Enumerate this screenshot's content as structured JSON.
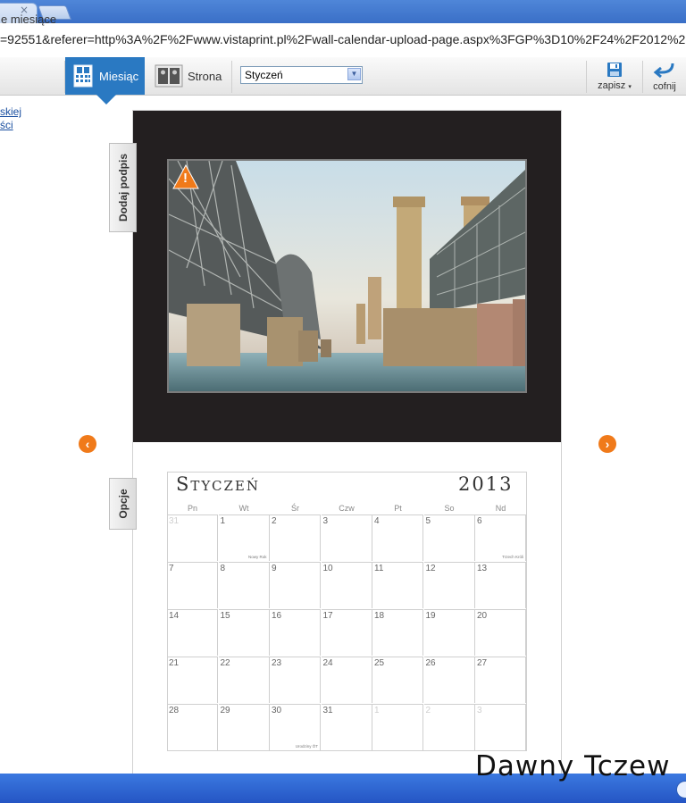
{
  "browser": {
    "url": "=92551&referer=http%3A%2F%2Fwww.vistaprint.pl%2Fwall-calendar-upload-page.aspx%3FGP%3D10%2F24%2F2012%2",
    "tab_close": "×"
  },
  "toolbar": {
    "all_months_label": "e miesiące",
    "month_label": "Miesiąc",
    "page_label": "Strona",
    "month_select_value": "Styczeń",
    "save_label": "zapisz",
    "undo_label": "cofnij"
  },
  "left_links": [
    "skiej",
    "ści"
  ],
  "editor": {
    "add_caption_label": "Dodaj podpis",
    "options_label": "Opcje",
    "warning_symbol": "!"
  },
  "calendar": {
    "month": "Styczeń",
    "year": "2013",
    "weekdays": [
      "Pn",
      "Wt",
      "Śr",
      "Czw",
      "Pt",
      "So",
      "Nd"
    ],
    "weeks": [
      [
        {
          "d": "31",
          "out": true
        },
        {
          "d": "1",
          "note": "Nowy Rok"
        },
        {
          "d": "2"
        },
        {
          "d": "3"
        },
        {
          "d": "4"
        },
        {
          "d": "5"
        },
        {
          "d": "6",
          "note": "Trzech Króli"
        }
      ],
      [
        {
          "d": "7"
        },
        {
          "d": "8"
        },
        {
          "d": "9"
        },
        {
          "d": "10"
        },
        {
          "d": "11"
        },
        {
          "d": "12"
        },
        {
          "d": "13"
        }
      ],
      [
        {
          "d": "14"
        },
        {
          "d": "15"
        },
        {
          "d": "16"
        },
        {
          "d": "17"
        },
        {
          "d": "18"
        },
        {
          "d": "19"
        },
        {
          "d": "20"
        }
      ],
      [
        {
          "d": "21"
        },
        {
          "d": "22"
        },
        {
          "d": "23"
        },
        {
          "d": "24"
        },
        {
          "d": "25"
        },
        {
          "d": "26"
        },
        {
          "d": "27"
        }
      ],
      [
        {
          "d": "28"
        },
        {
          "d": "29"
        },
        {
          "d": "30",
          "note": "Urodziny ÖT"
        },
        {
          "d": "31"
        },
        {
          "d": "1",
          "out": true
        },
        {
          "d": "2",
          "out": true
        },
        {
          "d": "3",
          "out": true
        }
      ]
    ]
  },
  "watermark": "Dawny Tczew",
  "colors": {
    "accent": "#2a79c2",
    "nav_arrow": "#f07a1a",
    "taskbar": "#2f64d0"
  }
}
